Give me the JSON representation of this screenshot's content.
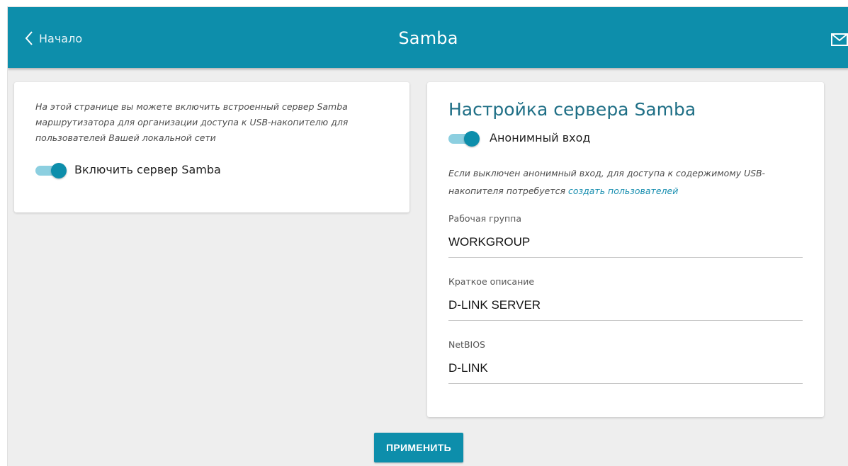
{
  "header": {
    "back_label": "Начало",
    "title": "Samba",
    "back_icon": "chevron-left-icon",
    "mail_icon": "envelope-icon"
  },
  "left_card": {
    "description": "На этой странице вы можете включить встроенный сервер Samba маршрутизатора для организации доступа к USB-накопителю для пользователей Вашей локальной сети",
    "toggle_label": "Включить сервер Samba",
    "toggle_on": true
  },
  "right_card": {
    "title": "Настройка сервера Samba",
    "toggle_label": "Анонимный вход",
    "toggle_on": true,
    "note_text": "Если выключен анонимный вход, для доступа к содержимому USB-накопителя потребуется ",
    "note_link": "создать пользователей",
    "fields": [
      {
        "label": "Рабочая группа",
        "value": "WORKGROUP"
      },
      {
        "label": "Краткое описание",
        "value": "D-LINK SERVER"
      },
      {
        "label": "NetBIOS",
        "value": "D-LINK"
      }
    ]
  },
  "apply_label": "ПРИМЕНИТЬ",
  "colors": {
    "accent": "#0d8eab",
    "background": "#eeeeee",
    "title": "#1f6f86"
  }
}
